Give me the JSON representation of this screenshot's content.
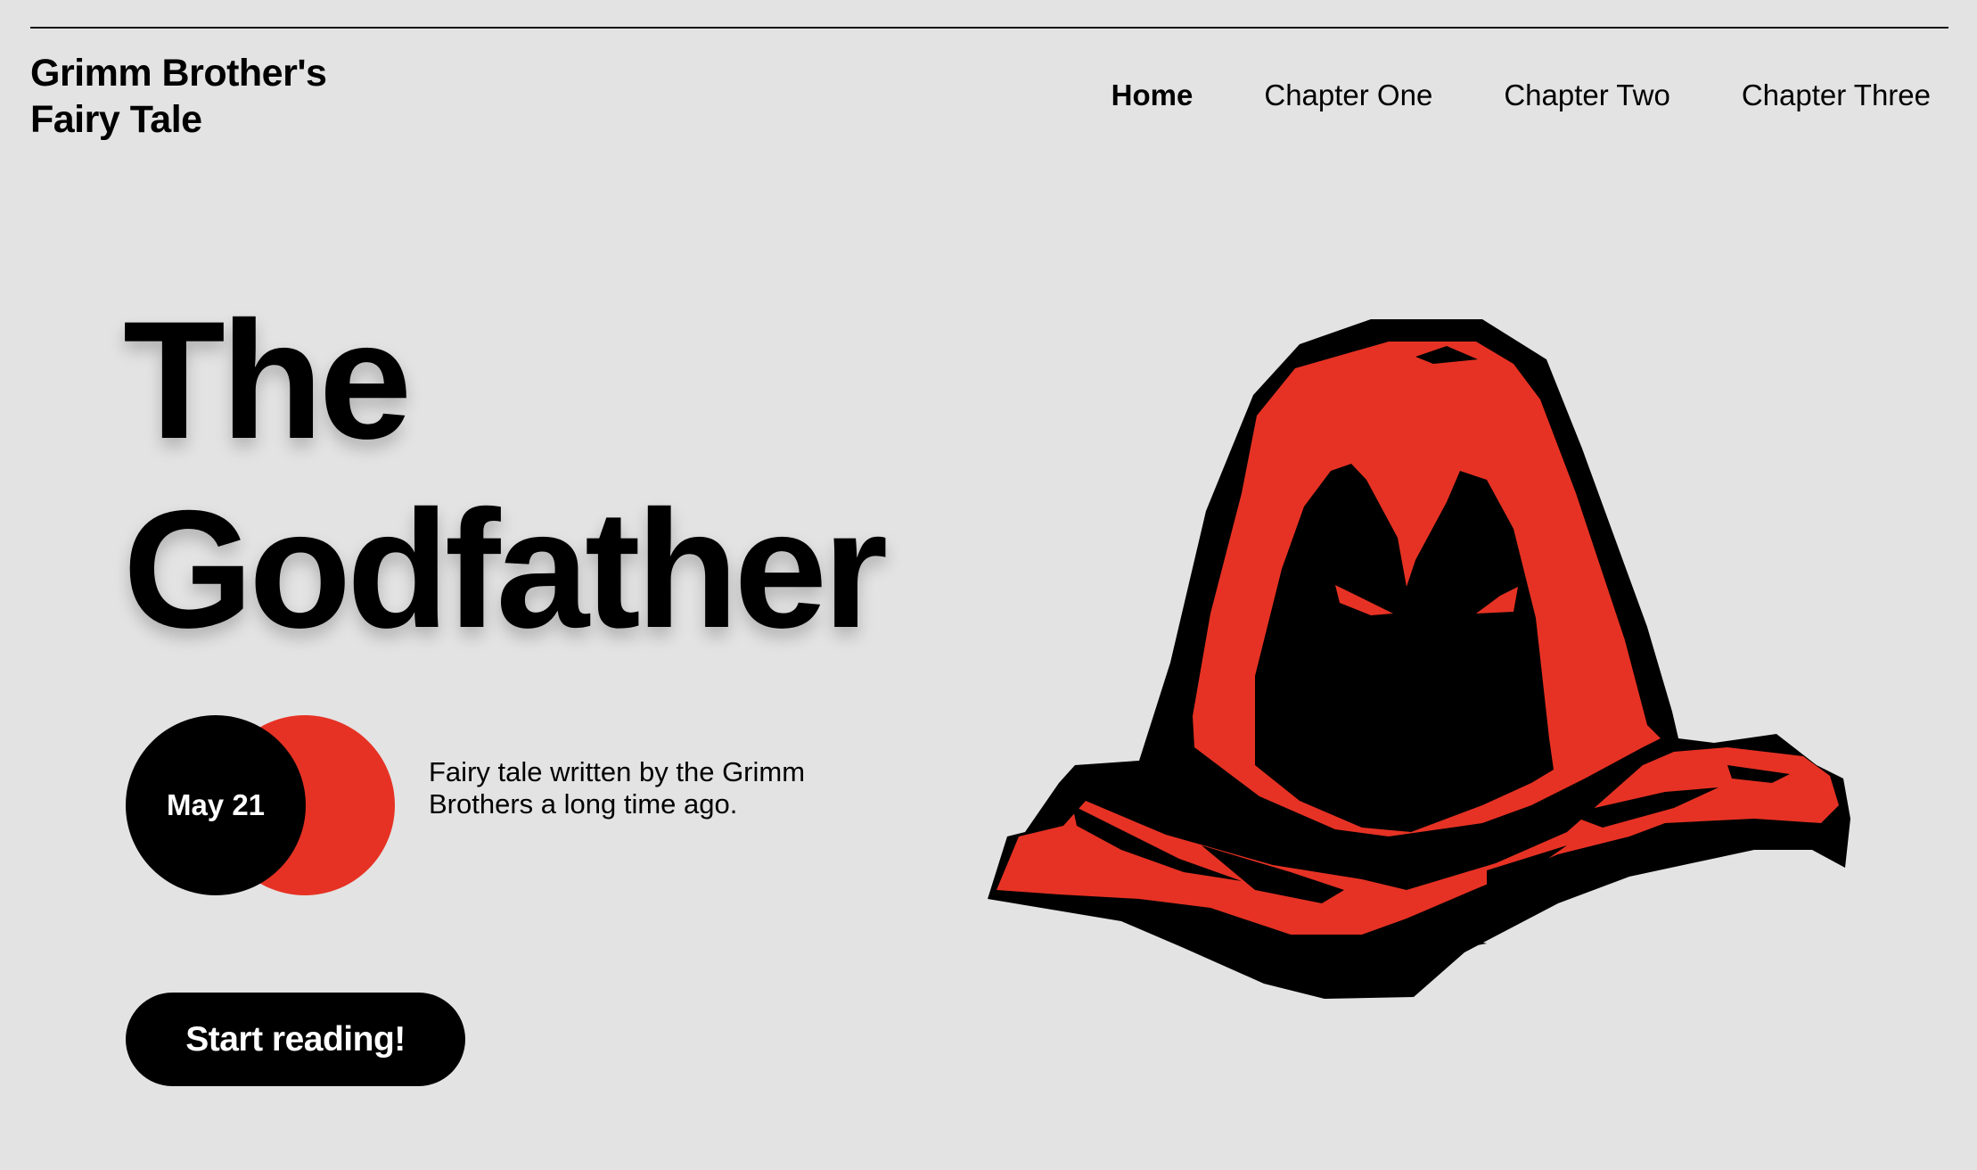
{
  "brand": {
    "line1": "Grimm Brother's",
    "line2": "Fairy Tale"
  },
  "nav": {
    "items": [
      {
        "label": "Home",
        "active": true
      },
      {
        "label": "Chapter One",
        "active": false
      },
      {
        "label": "Chapter Two",
        "active": false
      },
      {
        "label": "Chapter Three",
        "active": false
      }
    ]
  },
  "hero": {
    "title_line1": "The",
    "title_line2": "Godfather",
    "date": "May 21",
    "description": "Fairy tale written by the Grimm Brothers a long time ago.",
    "cta_label": "Start reading!"
  },
  "colors": {
    "background": "#e3e3e3",
    "accent_red": "#e63224",
    "text": "#000000"
  },
  "illustration": {
    "icon": "hooded-figure-icon"
  }
}
